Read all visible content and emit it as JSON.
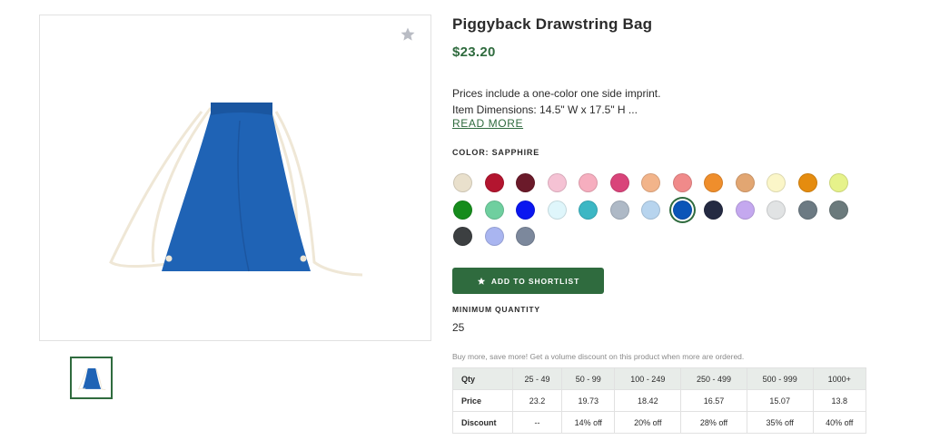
{
  "product": {
    "title": "Piggyback Drawstring Bag",
    "price": "$23.20",
    "description_lines": [
      "Prices include a one-color one side imprint.",
      "Item Dimensions: 14.5\" W x 17.5\" H ..."
    ],
    "read_more_label": "READ MORE",
    "color_label": "COLOR: SAPPHIRE",
    "add_to_shortlist_label": "ADD TO SHORTLIST",
    "minimum_quantity_label": "MINIMUM QUANTITY",
    "minimum_quantity_value": "25",
    "volume_note": "Buy more, save more! Get a volume discount on this product when more are ordered."
  },
  "colors": {
    "accent": "#2f6b3e",
    "bag": "#1f63b5"
  },
  "swatches": [
    {
      "color": "#e9e0cc",
      "selected": false
    },
    {
      "color": "#b3152f",
      "selected": false
    },
    {
      "color": "#6b1a2a",
      "selected": false
    },
    {
      "color": "#f5c2d4",
      "selected": false
    },
    {
      "color": "#f6aebf",
      "selected": false
    },
    {
      "color": "#d9447a",
      "selected": false
    },
    {
      "color": "#f2b48a",
      "selected": false
    },
    {
      "color": "#f08a8a",
      "selected": false
    },
    {
      "color": "#ef8e2c",
      "selected": false
    },
    {
      "color": "#e2a672",
      "selected": false
    },
    {
      "color": "#fbf6c8",
      "selected": false
    },
    {
      "color": "#e58c0f",
      "selected": false
    },
    {
      "color": "#e6f28a",
      "selected": false
    },
    {
      "color": "#168c1c",
      "selected": false
    },
    {
      "color": "#6fcf9f",
      "selected": false
    },
    {
      "color": "#0a16f0",
      "selected": false
    },
    {
      "color": "#dff6fb",
      "selected": false
    },
    {
      "color": "#3cb7c4",
      "selected": false
    },
    {
      "color": "#aeb9c6",
      "selected": false
    },
    {
      "color": "#b7d4ee",
      "selected": false
    },
    {
      "color": "#0b55b8",
      "selected": true
    },
    {
      "color": "#242a42",
      "selected": false
    },
    {
      "color": "#c4a8ef",
      "selected": false
    },
    {
      "color": "#e1e3e4",
      "selected": false
    },
    {
      "color": "#6c7a83",
      "selected": false
    },
    {
      "color": "#6b7a7c",
      "selected": false
    },
    {
      "color": "#3c3f41",
      "selected": false
    },
    {
      "color": "#a9b5f0",
      "selected": false
    },
    {
      "color": "#7c889c",
      "selected": false
    }
  ],
  "pricing": {
    "headers": [
      "Qty",
      "25 - 49",
      "50 - 99",
      "100 - 249",
      "250 - 499",
      "500 - 999",
      "1000+"
    ],
    "price_row": [
      "Price",
      "23.2",
      "19.73",
      "18.42",
      "16.57",
      "15.07",
      "13.8"
    ],
    "discount_row": [
      "Discount",
      "--",
      "14% off",
      "20% off",
      "28% off",
      "35% off",
      "40% off"
    ]
  }
}
